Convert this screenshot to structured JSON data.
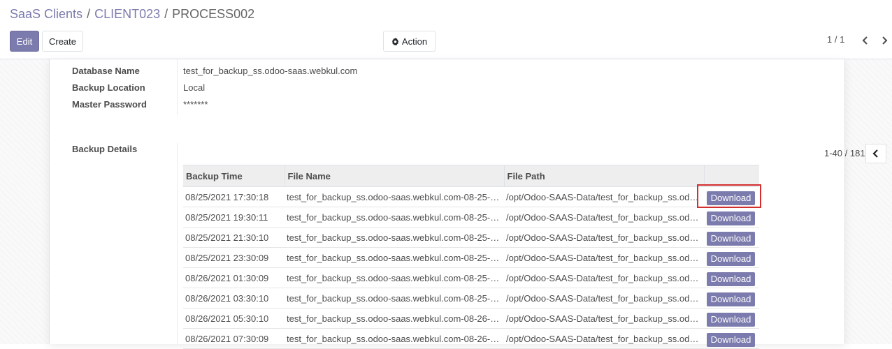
{
  "breadcrumb": {
    "items": [
      "SaaS Clients",
      "CLIENT023",
      "PROCESS002"
    ],
    "separator": "/"
  },
  "toolbar": {
    "edit_label": "Edit",
    "create_label": "Create",
    "action_label": "Action"
  },
  "pager": {
    "value": "1 / 1"
  },
  "fields": {
    "database_name": {
      "label": "Database Name",
      "value": "test_for_backup_ss.odoo-saas.webkul.com"
    },
    "backup_location": {
      "label": "Backup Location",
      "value": "Local"
    },
    "master_password": {
      "label": "Master Password",
      "value": "*******"
    },
    "backup_details_label": "Backup Details"
  },
  "backup_list": {
    "pager": "1-40 / 181",
    "columns": [
      "Backup Time",
      "File Name",
      "File Path",
      ""
    ],
    "download_label": "Download",
    "rows": [
      {
        "time": "08/25/2021 17:30:18",
        "file_name": "test_for_backup_ss.odoo-saas.webkul.com-08-25-…",
        "file_path": "/opt/Odoo-SAAS-Data/test_for_backup_ss.od…"
      },
      {
        "time": "08/25/2021 19:30:11",
        "file_name": "test_for_backup_ss.odoo-saas.webkul.com-08-25-…",
        "file_path": "/opt/Odoo-SAAS-Data/test_for_backup_ss.od…"
      },
      {
        "time": "08/25/2021 21:30:10",
        "file_name": "test_for_backup_ss.odoo-saas.webkul.com-08-25-…",
        "file_path": "/opt/Odoo-SAAS-Data/test_for_backup_ss.od…"
      },
      {
        "time": "08/25/2021 23:30:09",
        "file_name": "test_for_backup_ss.odoo-saas.webkul.com-08-25-…",
        "file_path": "/opt/Odoo-SAAS-Data/test_for_backup_ss.od…"
      },
      {
        "time": "08/26/2021 01:30:09",
        "file_name": "test_for_backup_ss.odoo-saas.webkul.com-08-25-…",
        "file_path": "/opt/Odoo-SAAS-Data/test_for_backup_ss.od…"
      },
      {
        "time": "08/26/2021 03:30:10",
        "file_name": "test_for_backup_ss.odoo-saas.webkul.com-08-25-…",
        "file_path": "/opt/Odoo-SAAS-Data/test_for_backup_ss.od…"
      },
      {
        "time": "08/26/2021 05:30:10",
        "file_name": "test_for_backup_ss.odoo-saas.webkul.com-08-26-…",
        "file_path": "/opt/Odoo-SAAS-Data/test_for_backup_ss.od…"
      },
      {
        "time": "08/26/2021 07:30:09",
        "file_name": "test_for_backup_ss.odoo-saas.webkul.com-08-26-…",
        "file_path": "/opt/Odoo-SAAS-Data/test_for_backup_ss.od…"
      }
    ]
  },
  "colors": {
    "brand": "#7c7bad",
    "highlight": "#d32f2f"
  },
  "icons": {
    "action": "gear-icon",
    "pager_prev": "chevron-left-icon",
    "pager_next": "chevron-right-icon"
  }
}
